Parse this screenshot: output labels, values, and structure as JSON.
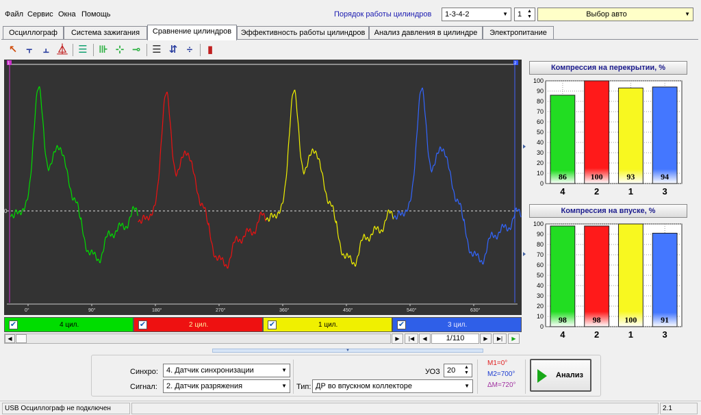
{
  "menu": {
    "items": [
      "Файл",
      "Сервис",
      "Окна",
      "Помощь"
    ],
    "cyl_order_label": "Порядок работы цилиндров",
    "cyl_order_value": "1-3-4-2",
    "start_cyl_value": "1",
    "auto_select": "Выбор авто"
  },
  "tabs": [
    {
      "label": "Осциллограф"
    },
    {
      "label": "Система зажигания"
    },
    {
      "label": "Сравнение цилиндров",
      "active": true
    },
    {
      "label": "Эффективность работы цилиндров"
    },
    {
      "label": "Анализ давления в цилиндре"
    },
    {
      "label": "Электропитание"
    }
  ],
  "toolbar": {
    "icons": [
      "cursor-select-icon",
      "rising-edge-icon",
      "falling-edge-icon",
      "pulse-edge-icon",
      "stack-icon",
      "cylinder-split-icon",
      "cursor-cross-icon",
      "cursor-offset-icon",
      "horizontal-lines-icon",
      "amplitude-icon",
      "vertical-resize-icon",
      "bar-chart-icon"
    ],
    "glyphs": [
      "↖",
      "⫟",
      "⫠",
      "⏅",
      "☰",
      "⊪",
      "⊹",
      "⊸",
      "☰",
      "⇵",
      "÷",
      "▮"
    ]
  },
  "scope": {
    "marker_left": "1",
    "marker_right": "2",
    "zero_label": "0",
    "degree_labels": [
      "0°",
      "90°",
      "180°",
      "270°",
      "360°",
      "450°",
      "540°",
      "630°"
    ],
    "colors": {
      "background": "#333333",
      "green": "#00dd00",
      "red": "#ee1111",
      "yellow": "#f0f000",
      "blue": "#3366ff"
    }
  },
  "channels": [
    {
      "label": "4 цил.",
      "color": "#00dd00",
      "checked": "✔"
    },
    {
      "label": "2 цил.",
      "color": "#ee1111",
      "checked": "✔"
    },
    {
      "label": "1 цил.",
      "color": "#f0f000",
      "checked": "✔"
    },
    {
      "label": "3 цил.",
      "color": "#2f5fe8",
      "checked": "✔"
    }
  ],
  "navigation": {
    "page": "1/110"
  },
  "chart_data": [
    {
      "type": "bar",
      "title": "Компрессия на перекрытии, %",
      "categories": [
        "4",
        "2",
        "1",
        "3"
      ],
      "values": [
        86,
        100,
        93,
        94
      ],
      "ylim": [
        0,
        100
      ],
      "yticks": [
        "0",
        "10",
        "20",
        "30",
        "40",
        "50",
        "60",
        "70",
        "80",
        "90",
        "100"
      ],
      "colors": [
        "#22dd22",
        "#ff1a1a",
        "#f8f820",
        "#4477ff"
      ]
    },
    {
      "type": "bar",
      "title": "Компрессия на впуске, %",
      "categories": [
        "4",
        "2",
        "1",
        "3"
      ],
      "values": [
        98,
        98,
        100,
        91
      ],
      "ylim": [
        0,
        100
      ],
      "yticks": [
        "0",
        "10",
        "20",
        "30",
        "40",
        "50",
        "60",
        "70",
        "80",
        "90",
        "100"
      ],
      "colors": [
        "#22dd22",
        "#ff1a1a",
        "#f8f820",
        "#4477ff"
      ]
    }
  ],
  "bottom": {
    "sync_label": "Синхро:",
    "sync_value": "4.  Датчик синхронизации",
    "signal_label": "Сигнал:",
    "signal_value": "2.  Датчик разряжения",
    "type_label": "Тип:",
    "type_value": "ДР во впускном коллекторе",
    "uoz_label": "УОЗ",
    "uoz_value": "20",
    "m1": "M1=0°",
    "m2": "M2=700°",
    "dm": "ΔM=720°",
    "analyze_label": "Анализ"
  },
  "status": {
    "left": "USB Осциллограф не подключен",
    "right": "2.1"
  }
}
